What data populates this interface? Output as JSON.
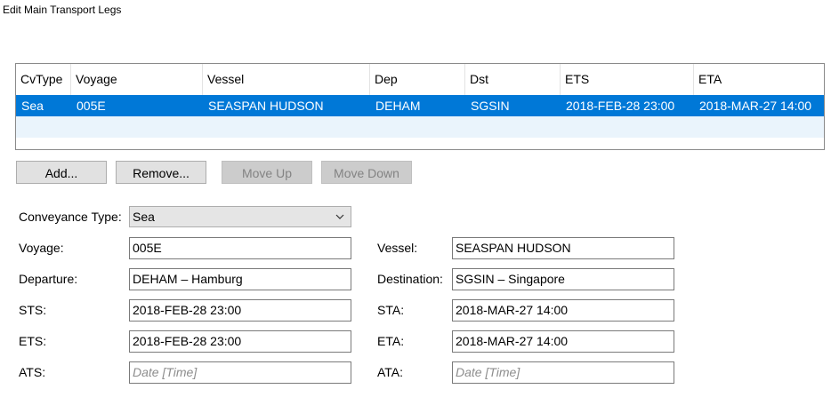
{
  "window": {
    "title": "Edit Main Transport Legs"
  },
  "grid": {
    "columns": [
      "CvType",
      "Voyage",
      "Vessel",
      "Dep",
      "Dst",
      "ETS",
      "ETA"
    ],
    "rows": [
      {
        "cvtype": "Sea",
        "voyage": "005E",
        "vessel": "SEASPAN HUDSON",
        "dep": "DEHAM",
        "dst": "SGSIN",
        "ets": "2018-FEB-28 23:00",
        "eta": "2018-MAR-27 14:00"
      }
    ]
  },
  "buttons": {
    "add": "Add...",
    "remove": "Remove...",
    "move_up": "Move Up",
    "move_down": "Move Down"
  },
  "form": {
    "conveyance_type": {
      "label": "Conveyance Type:",
      "value": "Sea"
    },
    "voyage": {
      "label": "Voyage:",
      "value": "005E"
    },
    "vessel": {
      "label": "Vessel:",
      "value": "SEASPAN HUDSON"
    },
    "departure": {
      "label": "Departure:",
      "value": "DEHAM – Hamburg"
    },
    "destination": {
      "label": "Destination:",
      "value": "SGSIN – Singapore"
    },
    "sts": {
      "label": "STS:",
      "value": "2018-FEB-28 23:00"
    },
    "sta": {
      "label": "STA:",
      "value": "2018-MAR-27 14:00"
    },
    "ets": {
      "label": "ETS:",
      "value": "2018-FEB-28 23:00"
    },
    "eta": {
      "label": "ETA:",
      "value": "2018-MAR-27 14:00"
    },
    "ats": {
      "label": "ATS:",
      "placeholder": "Date [Time]"
    },
    "ata": {
      "label": "ATA:",
      "placeholder": "Date [Time]"
    }
  },
  "colors": {
    "selection": "#0078d7",
    "empty_row": "#eaf4fc"
  }
}
